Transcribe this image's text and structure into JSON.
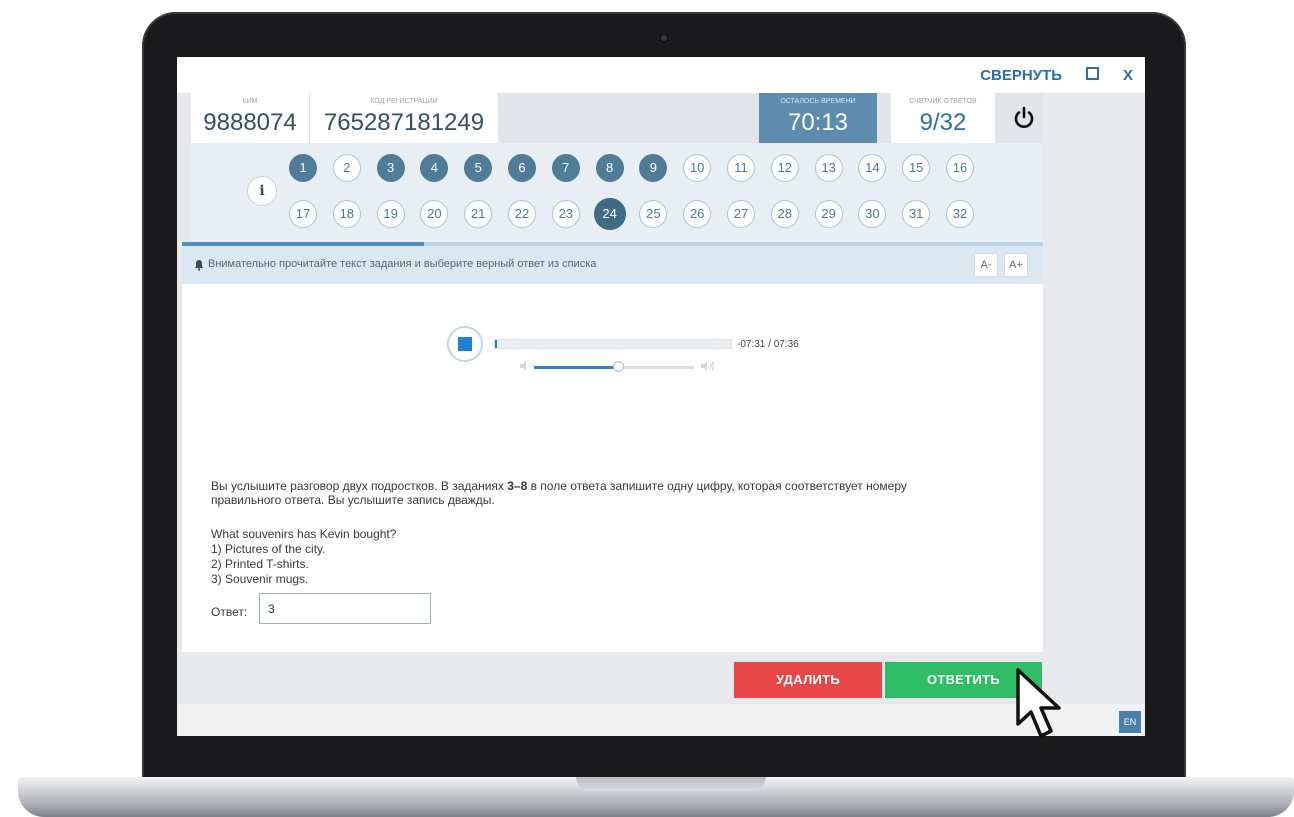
{
  "window": {
    "minimize_label": "СВЕРНУТЬ",
    "close_label": "X"
  },
  "header": {
    "kim_caption": "КИМ",
    "kim_value": "9888074",
    "reg_caption": "КОД РЕГИСТРАЦИИ",
    "reg_value": "765287181249",
    "timer_caption": "ОСТАЛОСЬ ВРЕМЕНИ",
    "timer_value": "70:13",
    "counter_caption": "СЧЕТЧИК ОТВЕТОВ",
    "counter_value": "9/32"
  },
  "nav": {
    "info_label": "i",
    "current_question": 24,
    "answered": [
      1,
      3,
      4,
      5,
      6,
      7,
      8,
      9
    ],
    "questions": [
      {
        "n": "1"
      },
      {
        "n": "2"
      },
      {
        "n": "3"
      },
      {
        "n": "4"
      },
      {
        "n": "5"
      },
      {
        "n": "6"
      },
      {
        "n": "7"
      },
      {
        "n": "8"
      },
      {
        "n": "9"
      },
      {
        "n": "10"
      },
      {
        "n": "11"
      },
      {
        "n": "12"
      },
      {
        "n": "13"
      },
      {
        "n": "14"
      },
      {
        "n": "15"
      },
      {
        "n": "16"
      },
      {
        "n": "17"
      },
      {
        "n": "18"
      },
      {
        "n": "19"
      },
      {
        "n": "20"
      },
      {
        "n": "21"
      },
      {
        "n": "22"
      },
      {
        "n": "23"
      },
      {
        "n": "24"
      },
      {
        "n": "25"
      },
      {
        "n": "26"
      },
      {
        "n": "27"
      },
      {
        "n": "28"
      },
      {
        "n": "29"
      },
      {
        "n": "30"
      },
      {
        "n": "31"
      },
      {
        "n": "32"
      }
    ]
  },
  "instruction": {
    "text": "Внимательно прочитайте текст задания и выберите верный ответ из списка",
    "font_decrease": "A-",
    "font_increase": "A+"
  },
  "audio": {
    "time": "-07:31 / 07:36",
    "progress_fraction": 0.01,
    "volume_fraction": 0.55
  },
  "task": {
    "intro_part1": "Вы услышите разговор двух подростков. В заданиях ",
    "intro_bold": "3–8",
    "intro_part2": " в поле ответа запишите одну цифру, которая соответствует номеру правильного ответа. Вы услышите запись дважды.",
    "question": "What souvenirs has Kevin bought?",
    "options": [
      "1) Pictures of the city.",
      "2) Printed T-shirts.",
      "3) Souvenir mugs."
    ],
    "answer_label": "Ответ:",
    "answer_value": "3"
  },
  "actions": {
    "delete_label": "УДАЛИТЬ",
    "answer_label": "ОТВЕТИТЬ",
    "lang_label": "EN"
  },
  "colors": {
    "accent": "#2c6ea5",
    "timer_bg": "#5d8cae",
    "answered_bg": "#4f7d97",
    "delete_bg": "#e84747",
    "answer_bg": "#2fbd66"
  }
}
